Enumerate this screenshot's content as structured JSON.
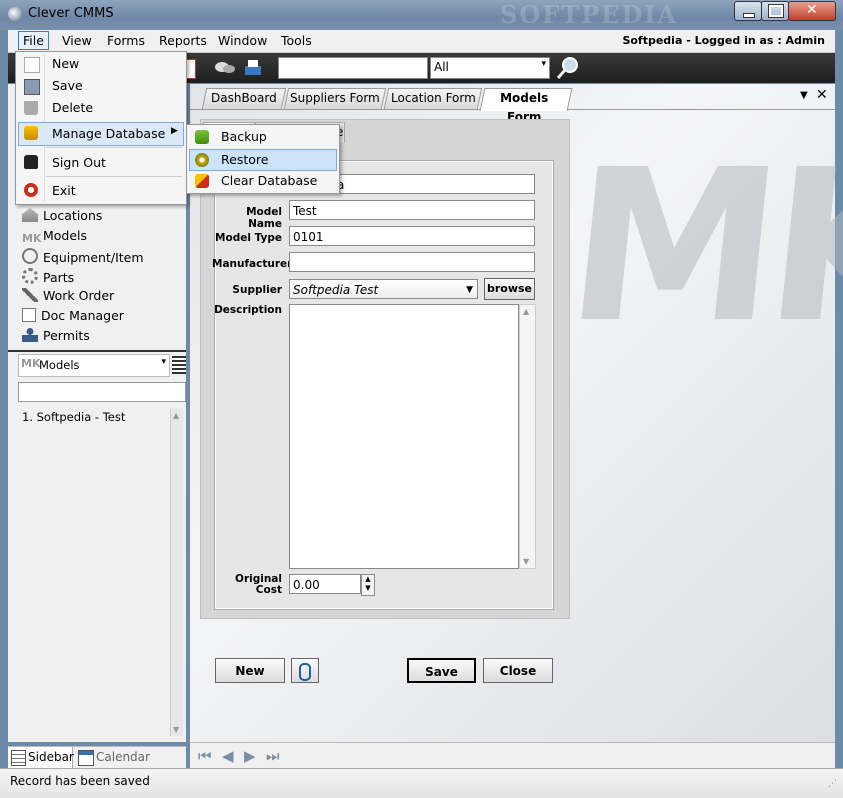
{
  "window": {
    "title": "Clever CMMS"
  },
  "menubar": {
    "items": [
      "File",
      "View",
      "Forms",
      "Reports",
      "Window",
      "Tools"
    ],
    "login_text": "Softpedia - Logged in as :  Admin"
  },
  "toolbar": {
    "search_value": "",
    "filter_value": "All"
  },
  "file_menu": {
    "items": [
      "New",
      "Save",
      "Delete",
      "Manage Database",
      "Sign Out",
      "Exit"
    ],
    "submenu": [
      "Backup",
      "Restore",
      "Clear Database"
    ]
  },
  "sidebar": {
    "nav": [
      "Locations",
      "Models",
      "Equipment/Item",
      "Parts",
      "Work Order",
      "Doc Manager",
      "Permits"
    ],
    "list_selector": "Models",
    "filter_value": "",
    "list_items": [
      "1. Softpedia - Test"
    ],
    "bottom_tabs": [
      "Sidebar",
      "Calendar"
    ]
  },
  "tabs": [
    "DashBoard",
    "Suppliers Form",
    "Location Form",
    "Models Form"
  ],
  "form": {
    "partial_field_value": "a",
    "labels": {
      "model_name": "Model Name",
      "model_type": "Model Type",
      "manufacturer": "Manufacturer",
      "supplier": "Supplier",
      "description": "Description",
      "original_cost_1": "Original",
      "original_cost_2": "Cost"
    },
    "values": {
      "model_name": "Test",
      "model_type": "0101",
      "manufacturer": "",
      "supplier": "Softpedia Test",
      "description": "",
      "original_cost": "0.00"
    },
    "browse_label": "browse",
    "tab_fragment": "e"
  },
  "buttons": {
    "new": "New",
    "save": "Save",
    "close": "Close"
  },
  "status": {
    "text": "Record has been saved"
  },
  "watermark": {
    "logo": "MK",
    "text": "SOFTPEDIA"
  }
}
